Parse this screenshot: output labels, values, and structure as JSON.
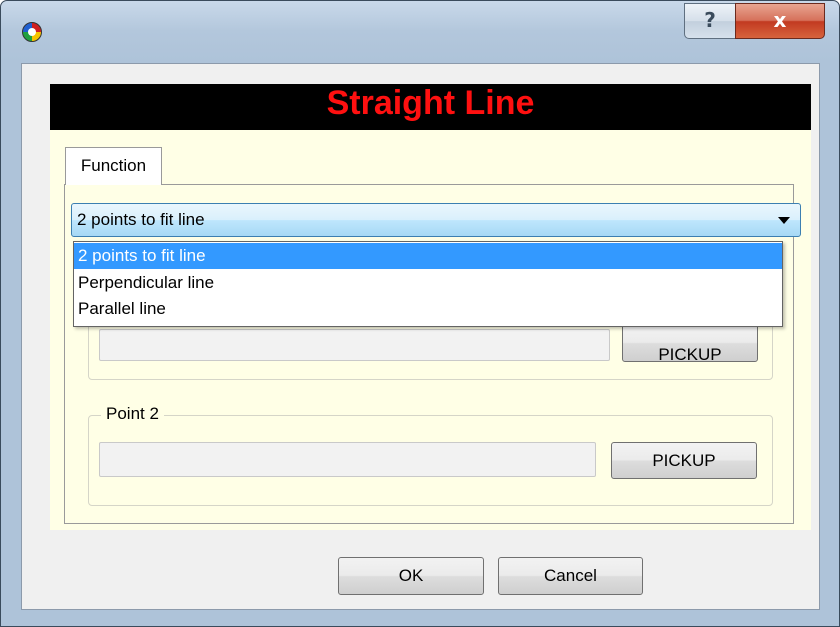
{
  "window": {
    "icon": "app-logo-icon",
    "help_label": "?",
    "close_label": "x"
  },
  "header": {
    "title": "Straight Line",
    "title_color": "#ff1010",
    "background": "#000000"
  },
  "tabs": [
    {
      "label": "Function"
    }
  ],
  "function_select": {
    "value": "2 points to fit line",
    "options": [
      {
        "label": "2 points to fit line",
        "selected": true
      },
      {
        "label": "Perpendicular line",
        "selected": false
      },
      {
        "label": "Parallel line",
        "selected": false
      }
    ]
  },
  "point1": {
    "pickup_label": "PICKUP",
    "value": ""
  },
  "point2": {
    "label": "Point 2",
    "pickup_label": "PICKUP",
    "value": ""
  },
  "buttons": {
    "ok_label": "OK",
    "cancel_label": "Cancel"
  },
  "colors": {
    "tab_background": "#ffffe6",
    "selection": "#3399ff"
  }
}
